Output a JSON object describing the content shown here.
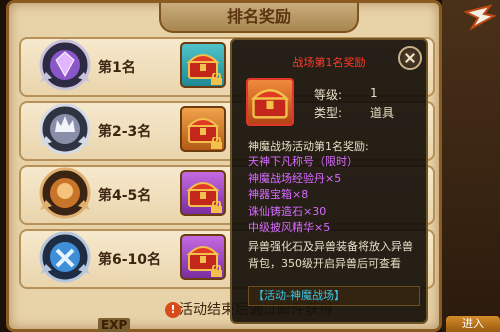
{
  "panel": {
    "title": "排名奖励"
  },
  "rows": [
    {
      "rank": "第1名",
      "medal_color": "#8a56c8"
    },
    {
      "rank": "第2-3名",
      "medal_color": "#8a8ea8"
    },
    {
      "rank": "第4-5名",
      "medal_color": "#c8752a"
    },
    {
      "rank": "第6-10名",
      "medal_color": "#3e8ed8"
    }
  ],
  "footer": {
    "text": "活动结束后通过邮件获得",
    "icon": "!"
  },
  "side": {
    "enter_label": "进入",
    "exp_label": "EXP"
  },
  "tooltip": {
    "title": "战场第1名奖励",
    "level_label": "等级:",
    "level_value": "1",
    "type_label": "类型:",
    "type_value": "道具",
    "section": "神魔战场活动第1名奖励:",
    "rewards": [
      "天神下凡称号（限时）",
      "神魔战场经验丹×5",
      "神器宝箱×8",
      "诛仙铸造石×30",
      "中级披风精华×5"
    ],
    "description": "异兽强化石及异兽装备将放入异兽背包，350级开启异兽后可查看",
    "link": "【活动-神魔战场】"
  }
}
